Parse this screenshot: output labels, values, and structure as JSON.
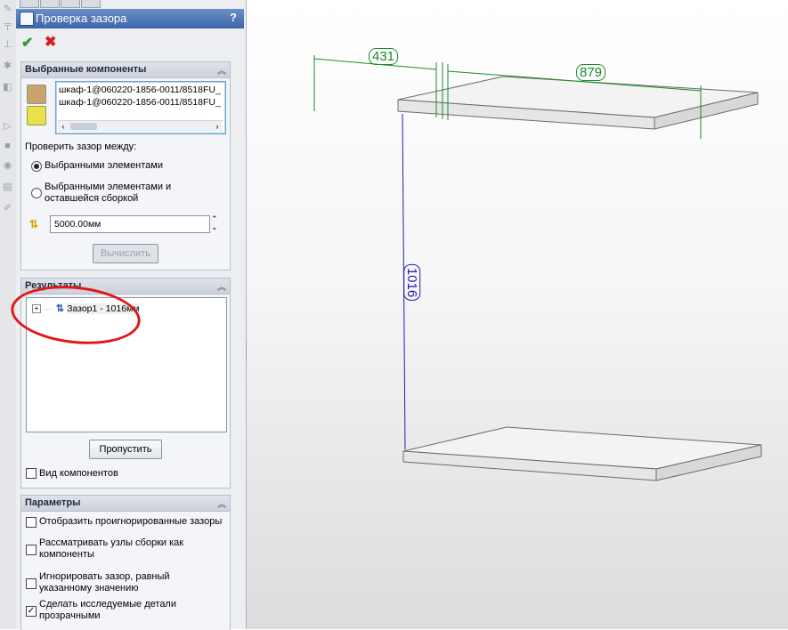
{
  "panel": {
    "title": "Проверка зазора",
    "help": "?",
    "ok_icon": "green-checkmark",
    "cancel_icon": "red-x"
  },
  "selected_components": {
    "header": "Выбранные компоненты",
    "items": [
      "шкаф-1@060220-1856-0011/8518FU_",
      "шкаф-1@060220-1856-0011/8518FU_"
    ],
    "check_between_label": "Проверить зазор между:",
    "options": [
      {
        "label": "Выбранными элементами",
        "selected": true
      },
      {
        "label": "Выбранными элементами и оставшейся сборкой",
        "selected": false
      }
    ],
    "clearance_value": "5000.00мм",
    "calculate_button": "Вычислить"
  },
  "results": {
    "header": "Результаты",
    "items": [
      {
        "label": "Зазор1 - 1016мм",
        "expand": "+"
      }
    ],
    "skip_button": "Пропустить",
    "view_components_label": "Вид компонентов",
    "view_components_checked": false
  },
  "parameters": {
    "header": "Параметры",
    "options": [
      {
        "label": "Отобразить проигнорированные зазоры",
        "checked": false
      },
      {
        "label": "Рассматривать узлы сборки как компоненты",
        "checked": false
      },
      {
        "label": "Игнорировать зазор, равный указанному значению",
        "checked": false
      },
      {
        "label": "Сделать исследуемые детали прозрачными",
        "checked": true
      }
    ]
  },
  "viewport": {
    "dimensions": [
      "431",
      "879",
      "1016"
    ],
    "dim_color_green": "#1a8a2a",
    "dim_color_blue": "#1f1fb0",
    "annotation_color": "#e01818"
  }
}
